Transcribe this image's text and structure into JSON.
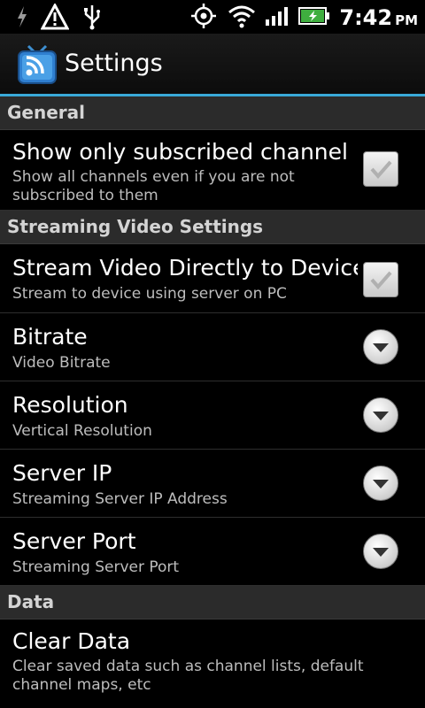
{
  "status_bar": {
    "time": "7:42",
    "ampm": "PM",
    "icons": [
      "bolt-icon",
      "warning-icon",
      "usb-icon",
      "gps-icon",
      "wifi-icon",
      "signal-icon",
      "battery-icon"
    ]
  },
  "title_bar": {
    "title": "Settings",
    "icon": "rss-tv-icon"
  },
  "categories": {
    "general": "General",
    "streaming": "Streaming Video Settings",
    "data": "Data"
  },
  "items": {
    "subscribed": {
      "title": "Show only subscribed channels (",
      "summary": "Show all channels even if you are not subscribed to them",
      "checked": true
    },
    "stream": {
      "title": "Stream Video Directly to Device",
      "summary": "Stream to device using server on PC",
      "checked": true
    },
    "bitrate": {
      "title": "Bitrate",
      "summary": "Video Bitrate"
    },
    "resolution": {
      "title": "Resolution",
      "summary": "Vertical Resolution"
    },
    "server_ip": {
      "title": "Server IP",
      "summary": "Streaming Server IP Address"
    },
    "server_port": {
      "title": "Server Port",
      "summary": "Streaming Server Port"
    },
    "clear_data": {
      "title": "Clear Data",
      "summary": "Clear saved data such as channel lists, default channel maps, etc"
    }
  },
  "colors": {
    "accent": "#39a9d8",
    "category_bg": "#2b2b2b",
    "background": "#000000"
  }
}
